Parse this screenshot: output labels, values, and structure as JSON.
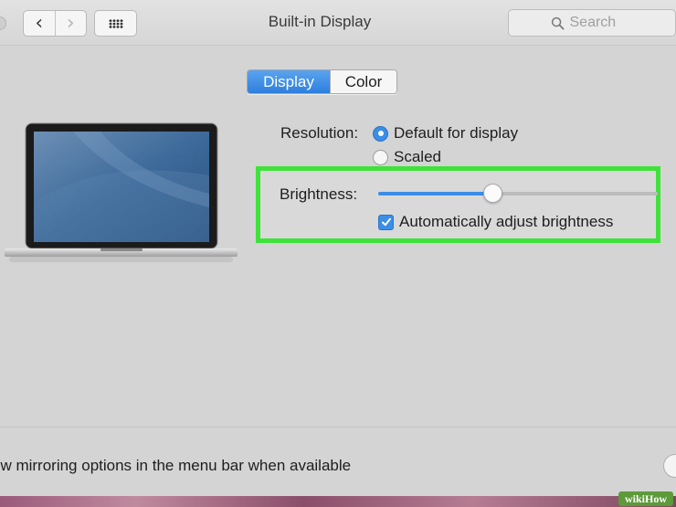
{
  "window": {
    "title": "Built-in Display",
    "search_placeholder": "Search"
  },
  "navigation": {
    "back_icon": "chevron-left-icon",
    "forward_icon": "chevron-right-icon",
    "show_all_icon": "grid-icon"
  },
  "tabs": [
    {
      "label": "Display",
      "selected": true
    },
    {
      "label": "Color",
      "selected": false
    }
  ],
  "resolution": {
    "label": "Resolution:",
    "options": [
      {
        "label": "Default for display",
        "selected": true
      },
      {
        "label": "Scaled",
        "selected": false
      }
    ]
  },
  "brightness": {
    "label": "Brightness:",
    "level_fraction": 0.41,
    "auto_adjust": {
      "label": "Automatically adjust brightness",
      "checked": true
    }
  },
  "footer": {
    "mirroring_text": "ow mirroring options in the menu bar when available"
  },
  "watermark": "wikiHow",
  "colors": {
    "accent": "#3b8ee6",
    "highlight_border": "#3fe23a",
    "window_bg": "#d4d4d4"
  }
}
